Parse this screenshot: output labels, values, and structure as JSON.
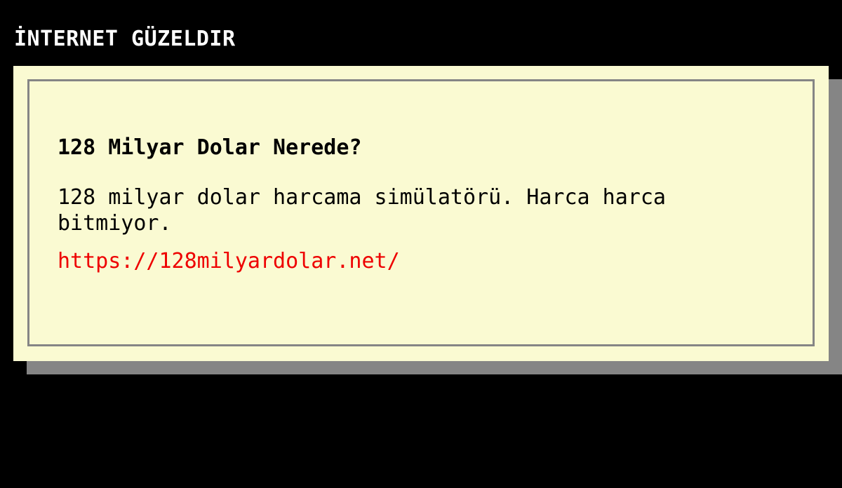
{
  "site": {
    "title": "İNTERNET GÜZELDIR"
  },
  "card": {
    "headline": "128 Milyar Dolar Nerede?",
    "description": "128 milyar dolar harcama simülatörü. Harca harca bitmiyor.",
    "link_text": "https://128milyardolar.net/"
  },
  "colors": {
    "background": "#000000",
    "card_background": "#fafad2",
    "card_shadow": "#858585",
    "link": "#ee0000"
  }
}
